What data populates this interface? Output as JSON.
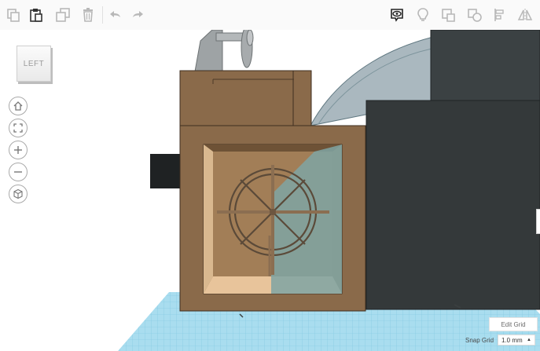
{
  "toolbar": {
    "items": [
      {
        "name": "copy-icon"
      },
      {
        "name": "paste-icon"
      },
      {
        "name": "duplicate-icon"
      },
      {
        "name": "delete-icon"
      },
      {
        "name": "undo-icon"
      },
      {
        "name": "redo-icon"
      },
      {
        "name": "visibility-icon"
      },
      {
        "name": "light-bulb-icon"
      },
      {
        "name": "group-icon"
      },
      {
        "name": "ungroup-icon"
      },
      {
        "name": "align-icon"
      },
      {
        "name": "mirror-icon"
      }
    ]
  },
  "viewcube": {
    "label": "LEFT"
  },
  "nav": [
    "home-icon",
    "fit-view-icon",
    "zoom-in-icon",
    "zoom-out-icon",
    "perspective-icon"
  ],
  "grid": {
    "edit_label": "Edit Grid",
    "snap_label": "Snap Grid",
    "snap_value": "1.0 mm",
    "snap_arrow": "▲"
  },
  "colors": {
    "wood": "#8a6a4a",
    "dark_block": "#34393a",
    "grid": "#9fd9ee",
    "glass": "#7fa5a3",
    "toolbar_icon": "#b8b8b8",
    "active_icon": "#222222"
  }
}
